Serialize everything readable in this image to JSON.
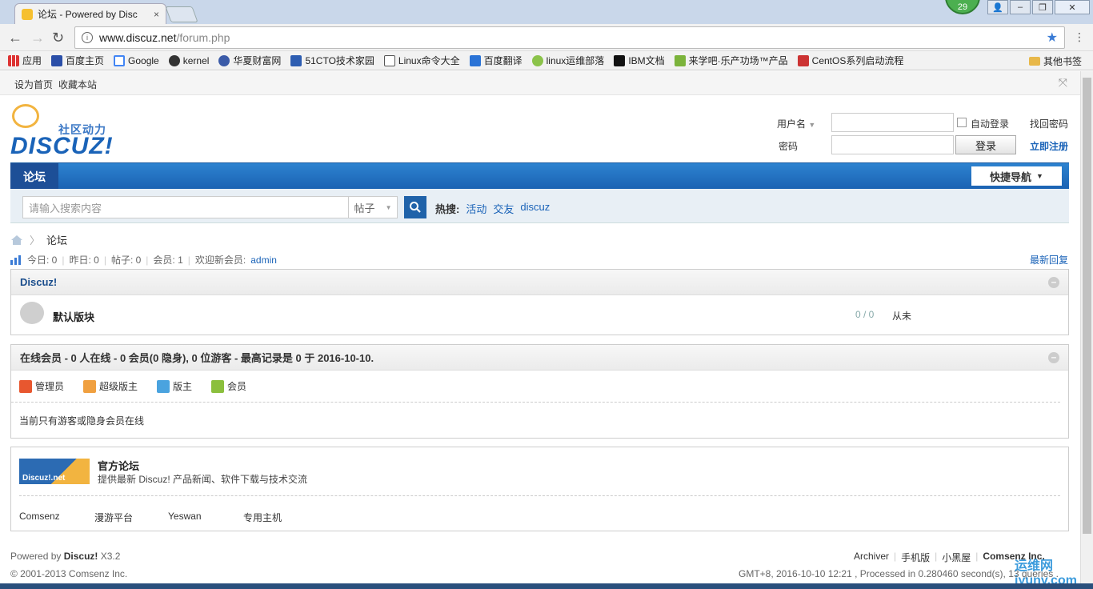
{
  "browser": {
    "tab_title": "论坛 - Powered by Disc",
    "tab_close": "×",
    "ext_badge": "29",
    "url_host": "www.discuz.net",
    "url_path": "/forum.php",
    "bookmarks": [
      "应用",
      "百度主页",
      "Google",
      "kernel",
      "华夏财富网",
      "51CTO技术家园",
      "Linux命令大全",
      "百度翻译",
      "linux运维部落",
      "IBM文档",
      "来学吧·乐产功场™产品",
      "CentOS系列启动流程"
    ],
    "other_bookmarks": "其他书签"
  },
  "topbar": {
    "set_home": "设为首页",
    "favorite": "收藏本站"
  },
  "logo": {
    "slogan": "社区动力",
    "wordmark": "DISCUZ!"
  },
  "login": {
    "username_label": "用户名",
    "password_label": "密码",
    "auto_login": "自动登录",
    "login_button": "登录",
    "forgot_password": "找回密码",
    "register": "立即注册"
  },
  "nav": {
    "forum": "论坛",
    "quick_nav": "快捷导航"
  },
  "search": {
    "placeholder": "请输入搜索内容",
    "type": "帖子",
    "hot_label": "热搜:",
    "hot_terms": [
      "活动",
      "交友",
      "discuz"
    ]
  },
  "breadcrumb": {
    "current": "论坛"
  },
  "stats": {
    "today": "今日: 0",
    "yesterday": "昨日: 0",
    "posts": "帖子: 0",
    "members": "会员: 1",
    "welcome": "欢迎新会员:",
    "newest_member": "admin",
    "latest_reply": "最新回复"
  },
  "category": {
    "title": "Discuz!",
    "forum_name": "默认版块",
    "counts": "0 / 0",
    "last_post": "从未"
  },
  "online": {
    "title": "在线会员 - 0 人在线 - 0 会员(0 隐身), 0 位游客 - 最高记录是 0 于 2016-10-10.",
    "legend": [
      "管理员",
      "超级版主",
      "版主",
      "会员"
    ],
    "legend_colors": [
      "#e8572f",
      "#f0a040",
      "#4aa3df",
      "#8bbf3d"
    ],
    "note": "当前只有游客或隐身会员在线"
  },
  "official": {
    "image_text": "Discuz!.net",
    "title": "官方论坛",
    "desc": "提供最新 Discuz! 产品新闻、软件下载与技术交流",
    "links": [
      "Comsenz",
      "漫游平台",
      "Yeswan",
      "专用主机"
    ]
  },
  "footer": {
    "powered_prefix": "Powered by",
    "powered_name": "Discuz!",
    "version": "X3.2",
    "copyright": "© 2001-2013 Comsenz Inc.",
    "links": [
      "Archiver",
      "手机版",
      "小黑屋",
      "Comsenz Inc."
    ],
    "runtime": "GMT+8, 2016-10-10 12:21 , Processed in 0.280460 second(s), 13 queries ."
  },
  "watermark": "运维网 iyunv.com"
}
